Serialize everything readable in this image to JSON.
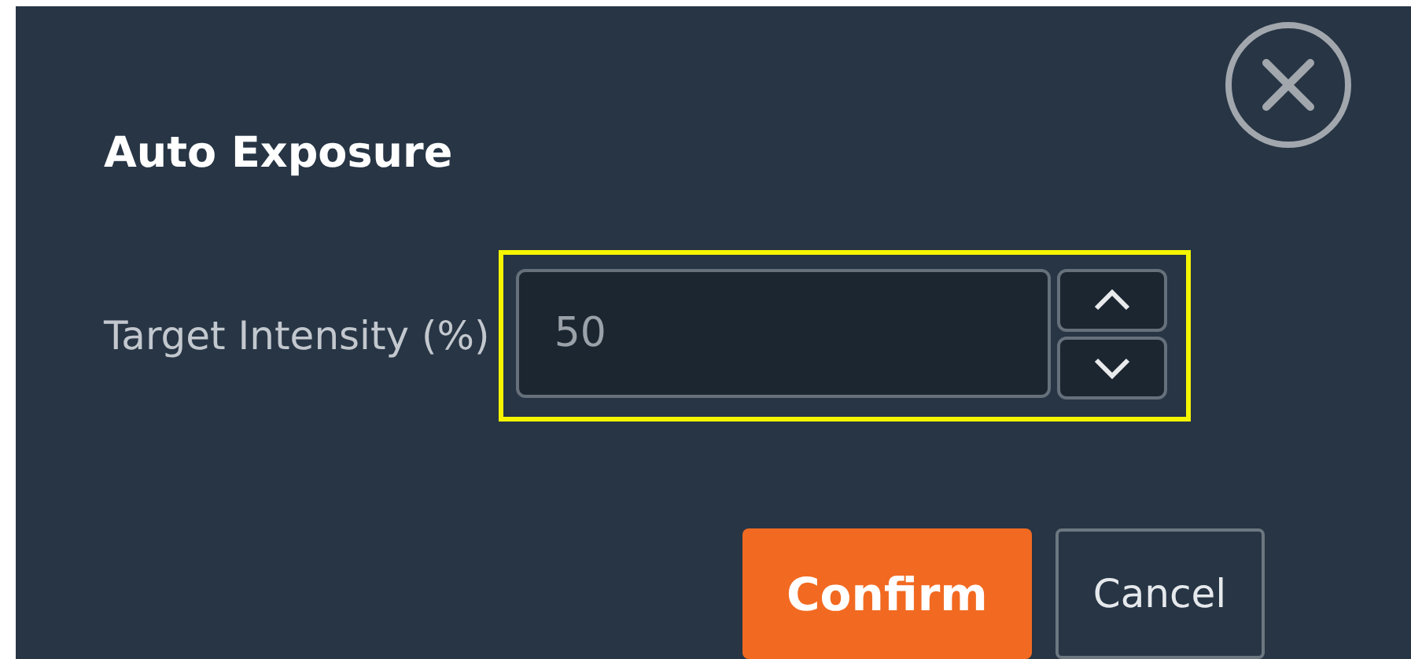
{
  "dialog": {
    "title": "Auto Exposure"
  },
  "field": {
    "label": "Target Intensity (%)",
    "value": "50",
    "highlighted": true
  },
  "buttons": [
    {
      "label": "Confirm",
      "kind": "primary"
    },
    {
      "label": "Cancel",
      "kind": "secondary"
    }
  ]
}
